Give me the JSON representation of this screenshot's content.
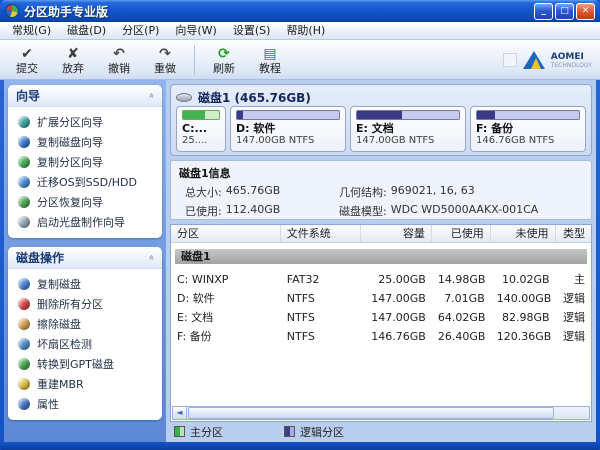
{
  "window": {
    "title": "分区助手专业版",
    "minimize": "_",
    "maximize": "□",
    "close": "✕"
  },
  "menubar": {
    "items": [
      "常规(G)",
      "磁盘(D)",
      "分区(P)",
      "向导(W)",
      "设置(S)",
      "帮助(H)"
    ]
  },
  "toolbar": {
    "group1": [
      {
        "label": "提交",
        "glyph": "✔",
        "color": "#3d3d3d"
      },
      {
        "label": "放弃",
        "glyph": "✘",
        "color": "#3d3d3d"
      },
      {
        "label": "撤销",
        "glyph": "↶",
        "color": "#4a4a4a"
      },
      {
        "label": "重做",
        "glyph": "↷",
        "color": "#4a4a4a"
      }
    ],
    "group2": [
      {
        "label": "刷新",
        "glyph": "⟳",
        "color": "#2a9a2a"
      },
      {
        "label": "教程",
        "glyph": "▤",
        "color": "#2a6ad0"
      }
    ],
    "brand": {
      "name": "AOMEI",
      "sub": "TECHNOLOGY"
    }
  },
  "sidebar": {
    "wizard_panel": {
      "title": "向导",
      "items": [
        {
          "label": "扩展分区向导",
          "icon_color": "#3aa8a0"
        },
        {
          "label": "复制磁盘向导",
          "icon_color": "#3a7ad0"
        },
        {
          "label": "复制分区向导",
          "icon_color": "#46b050"
        },
        {
          "label": "迁移OS到SSD/HDD",
          "icon_color": "#4a90d8"
        },
        {
          "label": "分区恢复向导",
          "icon_color": "#50a858"
        },
        {
          "label": "启动光盘制作向导",
          "icon_color": "#9aa8b8"
        }
      ]
    },
    "disk_ops_panel": {
      "title": "磁盘操作",
      "items": [
        {
          "label": "复制磁盘",
          "icon_color": "#4a86d8"
        },
        {
          "label": "删除所有分区",
          "icon_color": "#d84848"
        },
        {
          "label": "擦除磁盘",
          "icon_color": "#d8a050"
        },
        {
          "label": "坏扇区检测",
          "icon_color": "#5090d0"
        },
        {
          "label": "转换到GPT磁盘",
          "icon_color": "#48a850"
        },
        {
          "label": "重建MBR",
          "icon_color": "#e0c040"
        },
        {
          "label": "属性",
          "icon_color": "#4878c8"
        }
      ]
    }
  },
  "disk_panel": {
    "title": "磁盘1 (465.76GB)",
    "partitions": [
      {
        "label": "C:...",
        "size_line": "25....",
        "flex": "0 0 50px",
        "fill_pct": "60%",
        "fill_color": "#44b34e",
        "track_color": "#cfeec8",
        "bar_border": "#67a967"
      },
      {
        "label": "D: 软件",
        "size_line": "147.00GB NTFS",
        "flex": "1 1 0",
        "fill_pct": "6%",
        "fill_color": "#3a3a86",
        "track_color": "#c6cbee",
        "bar_border": "#7577ad"
      },
      {
        "label": "E: 文档",
        "size_line": "147.00GB NTFS",
        "flex": "1 1 0",
        "fill_pct": "44%",
        "fill_color": "#3a3a86",
        "track_color": "#c6cbee",
        "bar_border": "#7577ad"
      },
      {
        "label": "F: 备份",
        "size_line": "146.76GB NTFS",
        "flex": "1 1 0",
        "fill_pct": "18%",
        "fill_color": "#3a3a86",
        "track_color": "#c6cbee",
        "bar_border": "#7577ad"
      }
    ]
  },
  "disk_info": {
    "title": "磁盘1信息",
    "left_fields": [
      {
        "label": "总大小:",
        "value": "465.76GB"
      },
      {
        "label": "已使用:",
        "value": "112.40GB"
      }
    ],
    "right_fields": [
      {
        "label": "几何结构:",
        "value": "969021, 16, 63"
      },
      {
        "label": "磁盘模型:",
        "value": "WDC WD5000AAKX-001CA"
      }
    ]
  },
  "table": {
    "headers": [
      "分区",
      "文件系统",
      "容量",
      "已使用",
      "未使用",
      "类型"
    ],
    "group_row": "磁盘1",
    "rows": [
      {
        "partition": "C: WINXP",
        "fs": "FAT32",
        "capacity": "25.00GB",
        "used": "14.98GB",
        "unused": "10.02GB",
        "type": "主"
      },
      {
        "partition": "D: 软件",
        "fs": "NTFS",
        "capacity": "147.00GB",
        "used": "7.01GB",
        "unused": "140.00GB",
        "type": "逻辑"
      },
      {
        "partition": "E: 文档",
        "fs": "NTFS",
        "capacity": "147.00GB",
        "used": "64.02GB",
        "unused": "82.98GB",
        "type": "逻辑"
      },
      {
        "partition": "F: 备份",
        "fs": "NTFS",
        "capacity": "146.76GB",
        "used": "26.40GB",
        "unused": "120.36GB",
        "type": "逻辑"
      }
    ],
    "scroll_left_arrow": "◄"
  },
  "legend": {
    "items": [
      {
        "label": "主分区",
        "color": "#3fae4a",
        "color2": "#b9e6b4"
      },
      {
        "label": "逻辑分区",
        "color": "#3c3c90",
        "color2": "#aaaadd"
      }
    ]
  }
}
